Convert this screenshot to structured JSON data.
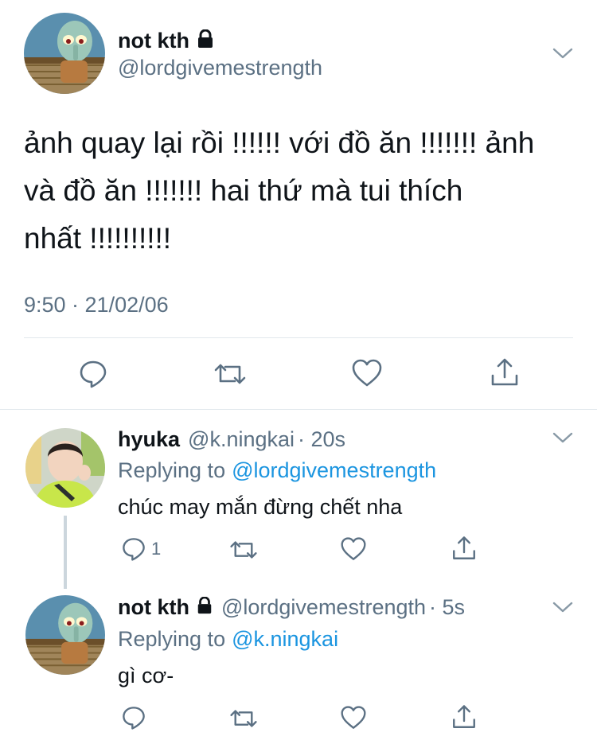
{
  "main_tweet": {
    "display_name": "not kth",
    "handle": "@lordgivemestrength",
    "text_lines": [
      "ảnh quay lại rồi !!!!!! với đồ ăn !!!!!!! ảnh",
      "và đồ ăn !!!!!!! hai thứ mà tui thích",
      "nhất !!!!!!!!!!"
    ],
    "timestamp": "9:50 · 21/02/06"
  },
  "replies": [
    {
      "display_name": "hyuka",
      "handle": "@k.ningkai",
      "time": "· 20s",
      "replying_prefix": "Replying to",
      "replying_to": "@lordgivemestrength",
      "text": "chúc may mắn đừng chết nha",
      "reply_count": "1"
    },
    {
      "display_name": "not kth",
      "handle": "@lordgivemestrength",
      "time": "· 5s",
      "replying_prefix": "Replying to",
      "replying_to": "@k.ningkai",
      "text": "gì cơ-",
      "reply_count": ""
    }
  ],
  "icons": {
    "reply": "reply-icon",
    "retweet": "retweet-icon",
    "like": "heart-icon",
    "share": "share-icon",
    "more": "chevron-down-icon",
    "protected": "lock-icon"
  },
  "colors": {
    "text": "#0f1419",
    "secondary": "#5b7083",
    "link": "#1b95e0",
    "divider": "#e1e8ed"
  }
}
